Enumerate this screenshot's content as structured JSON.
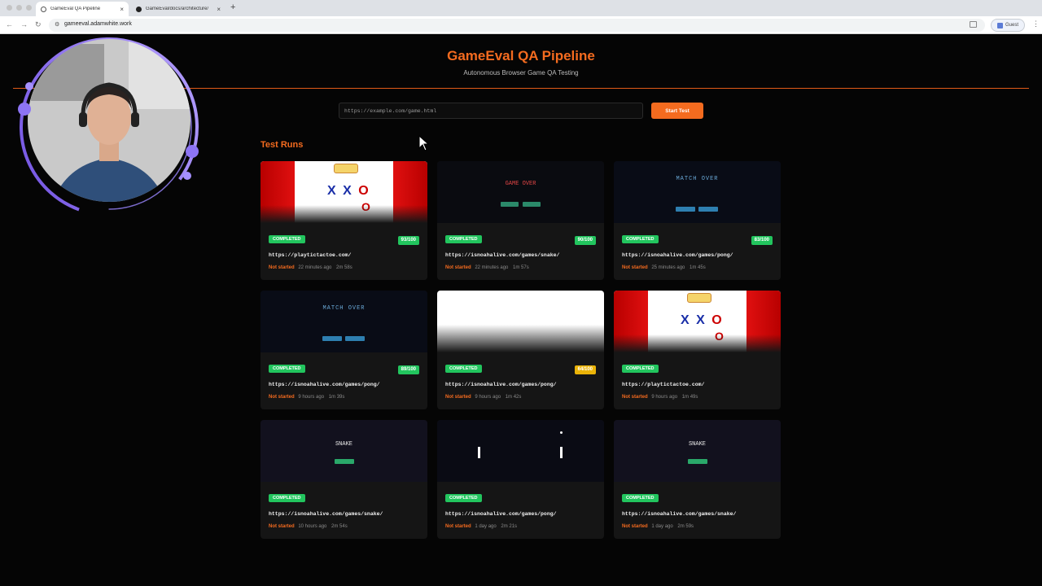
{
  "browser": {
    "tabs": [
      {
        "title": "GameEval QA Pipeline",
        "active": true
      },
      {
        "title": "GameEval/docs/architecture/",
        "active": false
      }
    ],
    "address": "gameeval.adamwhite.work",
    "profile_label": "Guest"
  },
  "app": {
    "title": "GameEval QA Pipeline",
    "subtitle": "Autonomous Browser Game QA Testing",
    "input_placeholder": "https://example.com/game.html",
    "start_button": "Start Test",
    "section_title": "Test Runs",
    "accent_color": "#f46b1f"
  },
  "runs": [
    {
      "status": "COMPLETED",
      "score": "93/100",
      "url": "https://playtictactoe.com/",
      "state": "Not started",
      "ago": "22 minutes ago",
      "duration": "2m 58s",
      "thumb": "tictactoe"
    },
    {
      "status": "COMPLETED",
      "score": "90/100",
      "url": "https://isnoahalive.com/games/snake/",
      "state": "Not started",
      "ago": "22 minutes ago",
      "duration": "1m 57s",
      "thumb": "game-over",
      "thumb_text": "GAME OVER"
    },
    {
      "status": "COMPLETED",
      "score": "83/100",
      "url": "https://isnoahalive.com/games/pong/",
      "state": "Not started",
      "ago": "25 minutes ago",
      "duration": "1m 45s",
      "thumb": "match-over",
      "thumb_text": "MATCH OVER"
    },
    {
      "status": "COMPLETED",
      "score": "89/100",
      "url": "https://isnoahalive.com/games/pong/",
      "state": "Not started",
      "ago": "9 hours ago",
      "duration": "1m 39s",
      "thumb": "match-over",
      "thumb_text": "MATCH OVER"
    },
    {
      "status": "COMPLETED",
      "score": "64/100",
      "url": "https://isnoahalive.com/games/pong/",
      "state": "Not started",
      "ago": "9 hours ago",
      "duration": "1m 42s",
      "thumb": "white"
    },
    {
      "status": "COMPLETED",
      "score": "",
      "url": "https://playtictactoe.com/",
      "state": "Not started",
      "ago": "9 hours ago",
      "duration": "1m 49s",
      "thumb": "tictactoe"
    },
    {
      "status": "COMPLETED",
      "score": "",
      "url": "https://isnoahalive.com/games/snake/",
      "state": "Not started",
      "ago": "10 hours ago",
      "duration": "2m 54s",
      "thumb": "snake",
      "thumb_text": "SNAKE"
    },
    {
      "status": "COMPLETED",
      "score": "",
      "url": "https://isnoahalive.com/games/pong/",
      "state": "Not started",
      "ago": "1 day ago",
      "duration": "2m 21s",
      "thumb": "pong"
    },
    {
      "status": "COMPLETED",
      "score": "",
      "url": "https://isnoahalive.com/games/snake/",
      "state": "Not started",
      "ago": "1 day ago",
      "duration": "2m 59s",
      "thumb": "snake",
      "thumb_text": "SNAKE"
    }
  ],
  "icons": {
    "cursor": "mouse-pointer-icon",
    "webcam": "presenter-webcam"
  }
}
